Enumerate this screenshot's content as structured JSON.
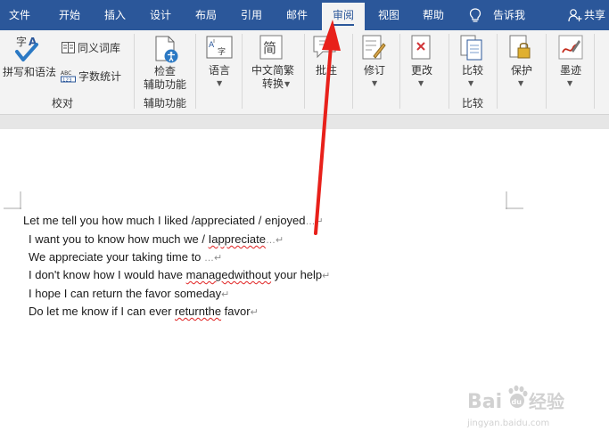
{
  "tabs": [
    "文件",
    "开始",
    "插入",
    "设计",
    "布局",
    "引用",
    "邮件",
    "审阅",
    "视图",
    "帮助"
  ],
  "tell_me": "告诉我",
  "share": "共享",
  "ribbon": {
    "spelling": "拼写和语法",
    "thesaurus": "同义词库",
    "word_count": "字数统计",
    "group_proofing": "校对",
    "check_line1": "检查",
    "check_line2": "辅助功能",
    "group_accessibility": "辅助功能",
    "language": "语言",
    "chinese_line1": "中文简繁",
    "chinese_line2": "转换",
    "comments": "批注",
    "tracking": "修订",
    "changes": "更改",
    "compare": "比较",
    "group_compare": "比较",
    "protect": "保护",
    "ink": "墨迹"
  },
  "document": {
    "lines": [
      {
        "text": "Let me tell you how much I liked /appreciated / enjoyed",
        "tail": "…↵"
      },
      {
        "text": "I want you to know how much we / ",
        "sq": "Iappreciate",
        "tail": "…↵"
      },
      {
        "text": "We appreciate your taking time to ",
        "tail": "…↵"
      },
      {
        "text": "I don't know how I would have ",
        "sq": "managedwithout",
        "rest": " your help",
        "tail": "↵"
      },
      {
        "text": "I hope I can return the favor someday",
        "tail": "↵"
      },
      {
        "text": "Do let me know if I can ever ",
        "sq": "returnthe",
        "rest": " favor",
        "tail": "↵"
      }
    ]
  },
  "watermark": {
    "main": "Bai",
    "paw": "du",
    "cn": "经验",
    "url": "jingyan.baidu.com"
  },
  "colors": {
    "accent": "#2b579a",
    "arrow": "#e8201a"
  }
}
